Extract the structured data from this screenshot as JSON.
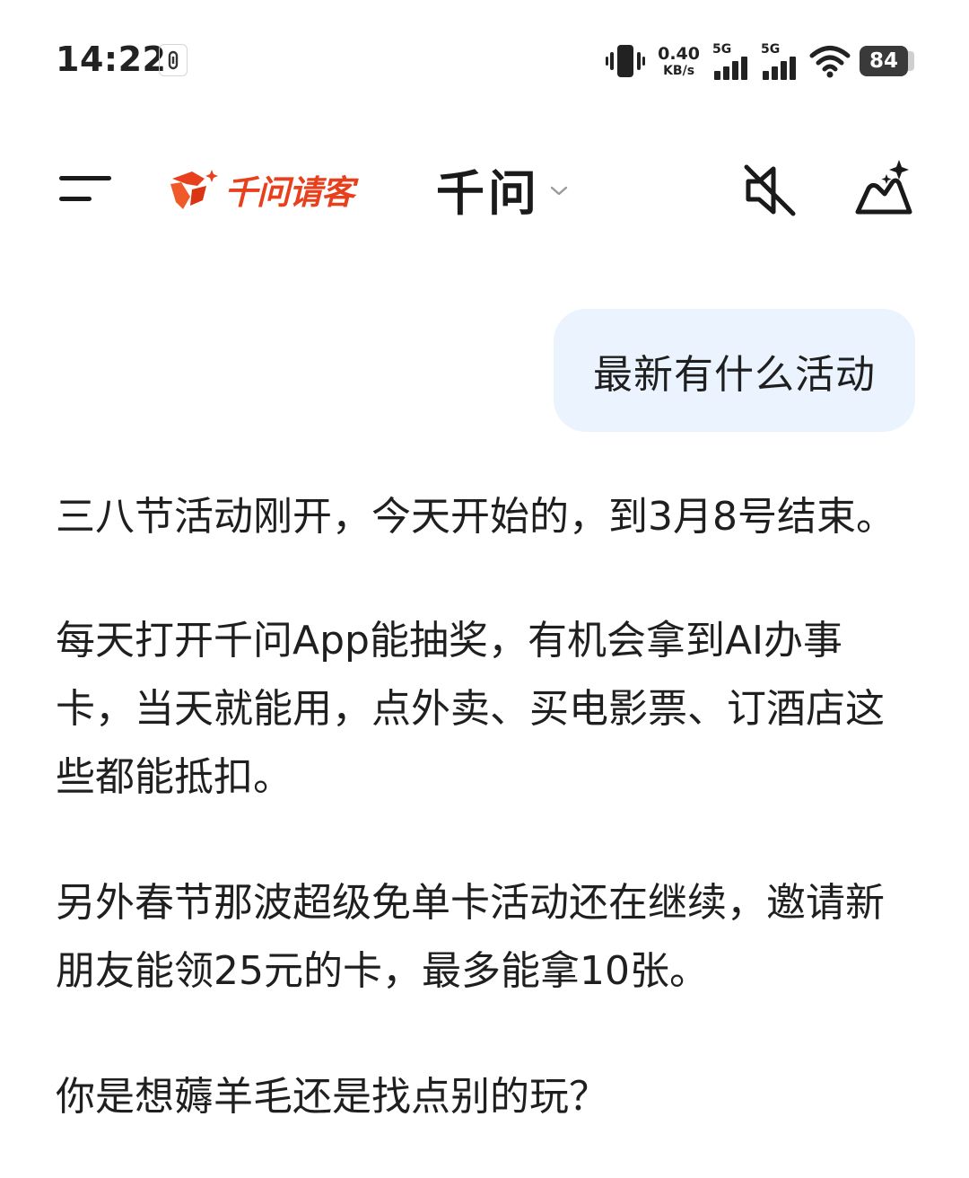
{
  "status_bar": {
    "time": "14:22",
    "net_speed_value": "0.40",
    "net_speed_unit": "KB/s",
    "signal1_label": "5G",
    "signal2_label": "5G",
    "battery": "84"
  },
  "navbar": {
    "promo_text": "千问请客",
    "title": "千问",
    "icons": [
      "menu-icon",
      "promo-logo-icon",
      "chevron-down-icon",
      "mute-icon",
      "new-chat-icon"
    ]
  },
  "chat": {
    "user_message": "最新有什么活动",
    "assistant_paragraphs": [
      "三八节活动刚开，今天开始的，到3月8号结束。",
      "每天打开千问App能抽奖，有机会拿到AI办事卡，当天就能用，点外卖、买电影票、订酒店这些都能抵扣。",
      "另外春节那波超级免单卡活动还在继续，邀请新朋友能领25元的卡，最多能拿10张。",
      "你是想薅羊毛还是找点别的玩？"
    ]
  },
  "colors": {
    "accent": "#e8401c",
    "user_bubble": "#eaf3fe",
    "text": "#1f1f1f"
  }
}
